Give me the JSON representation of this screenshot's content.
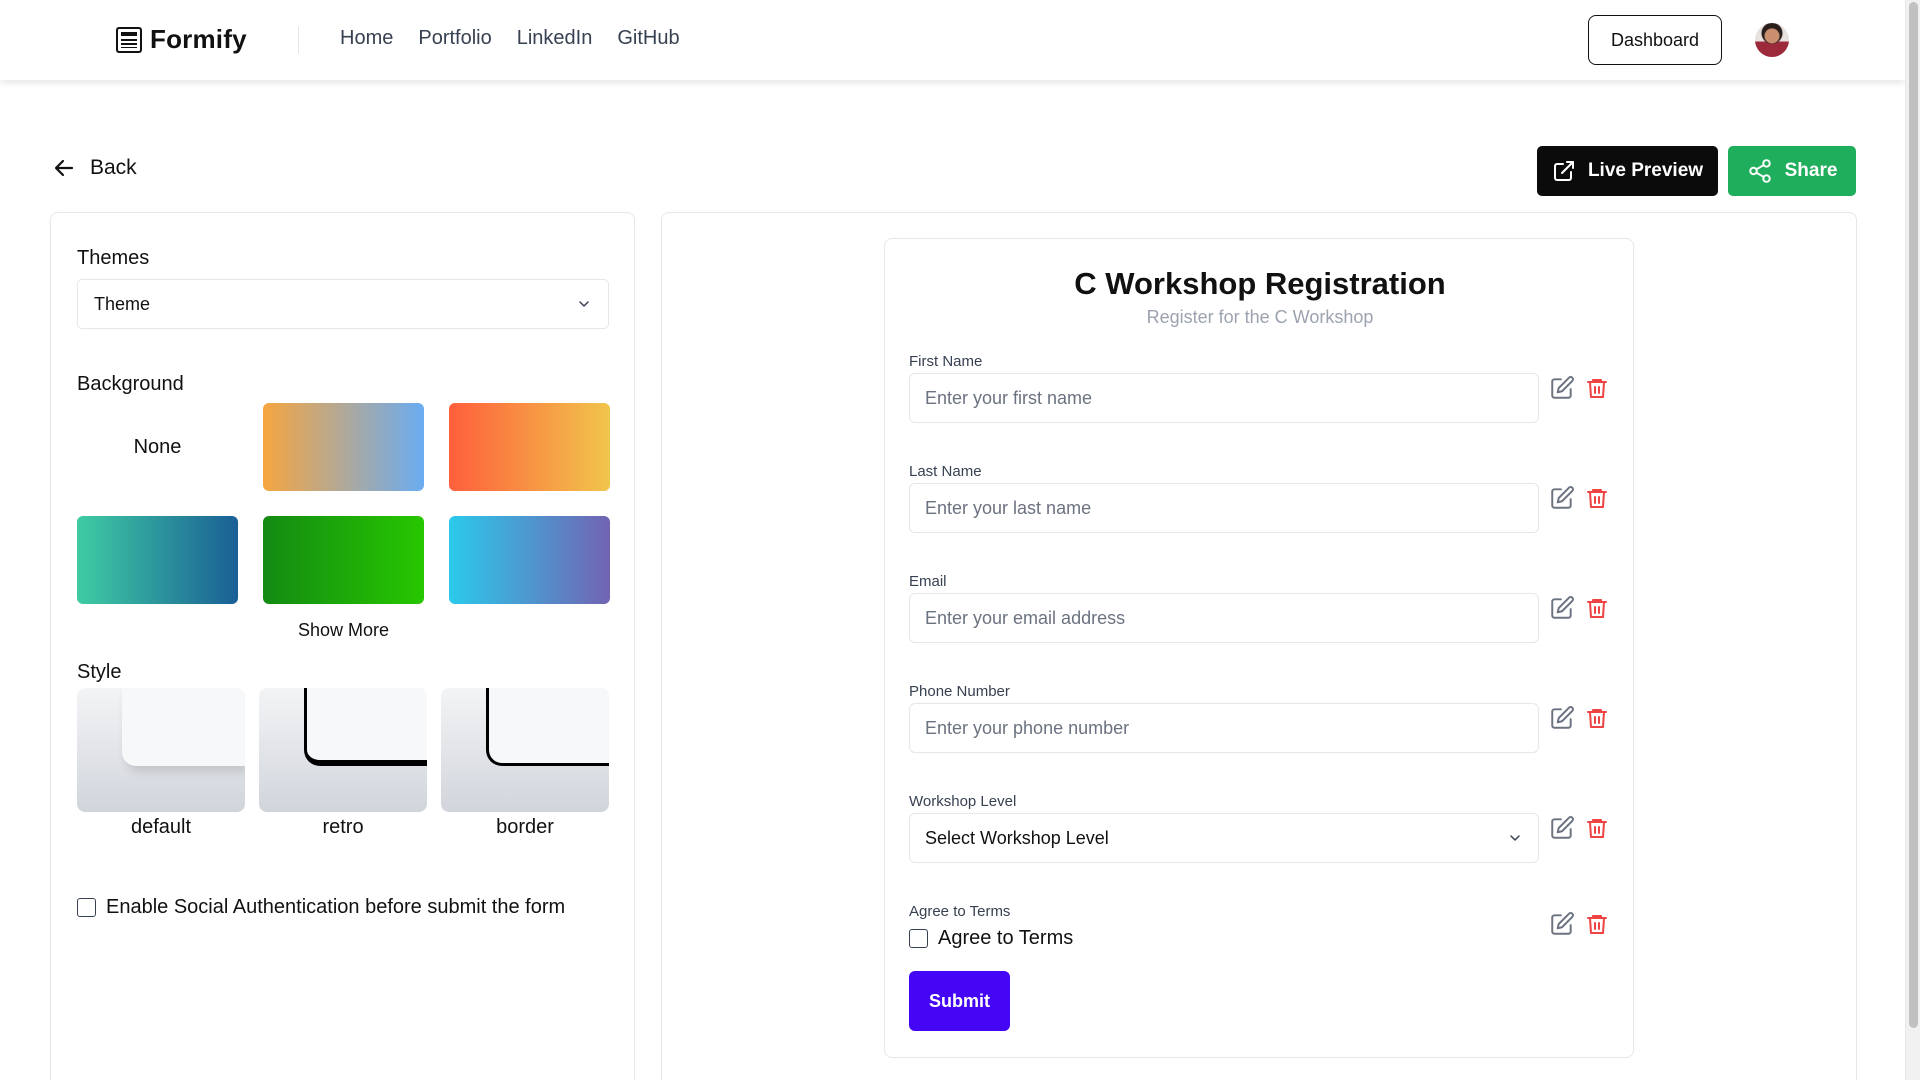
{
  "header": {
    "brand": "Formify",
    "nav": [
      "Home",
      "Portfolio",
      "LinkedIn",
      "GitHub"
    ],
    "dashboard_label": "Dashboard"
  },
  "actions": {
    "back_label": "Back",
    "live_preview_label": "Live Preview",
    "share_label": "Share"
  },
  "settings": {
    "themes_label": "Themes",
    "theme_value": "Theme",
    "background_label": "Background",
    "backgrounds": [
      {
        "label": "None",
        "css": "none"
      },
      {
        "css": "linear-gradient(90deg, #f6a540, #6aacf2)"
      },
      {
        "css": "linear-gradient(90deg, #ff5f3c, #f1c54b)"
      },
      {
        "css": "linear-gradient(90deg, #3fcca3, #1a5f95)"
      },
      {
        "css": "linear-gradient(90deg, #138a13, #27c700)"
      },
      {
        "css": "linear-gradient(90deg, #2bcaeb, #7263b2)"
      }
    ],
    "show_more_label": "Show More",
    "style_label": "Style",
    "styles": [
      "default",
      "retro",
      "border"
    ],
    "social_auth_label": "Enable Social Authentication before submit the form",
    "social_auth_checked": false
  },
  "form": {
    "title": "C Workshop Registration",
    "subtitle": "Register for the C Workshop",
    "fields": [
      {
        "label": "First Name",
        "placeholder": "Enter your first name",
        "type": "text"
      },
      {
        "label": "Last Name",
        "placeholder": "Enter your last name",
        "type": "text"
      },
      {
        "label": "Email",
        "placeholder": "Enter your email address",
        "type": "text"
      },
      {
        "label": "Phone Number",
        "placeholder": "Enter your phone number",
        "type": "text"
      },
      {
        "label": "Workshop Level",
        "value": "Select Workshop Level",
        "type": "select"
      },
      {
        "label": "Agree to Terms",
        "checkbox_label": "Agree to Terms",
        "type": "checkbox",
        "checked": false
      }
    ],
    "submit_label": "Submit"
  },
  "colors": {
    "primary": "#4406f4",
    "share": "#1fae5b",
    "danger": "#ef4444",
    "dark": "#0b0b0b"
  }
}
